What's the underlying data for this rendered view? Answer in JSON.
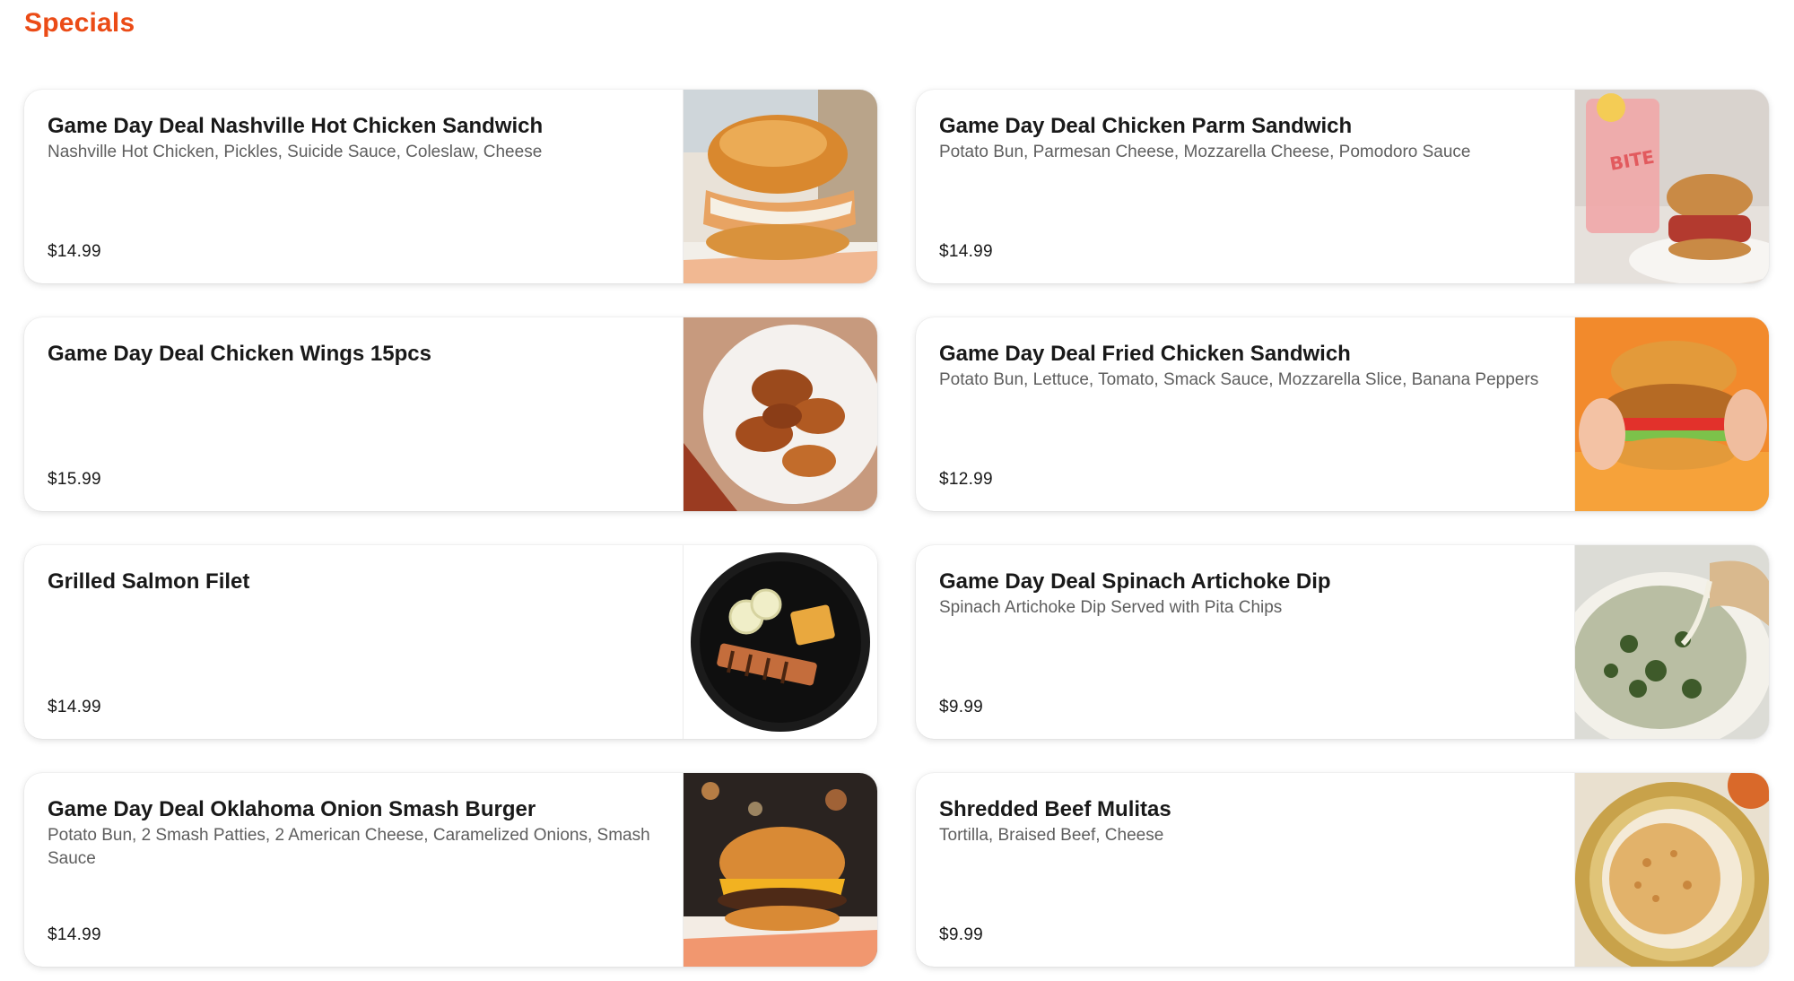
{
  "section": {
    "title": "Specials"
  },
  "items": [
    {
      "name": "Game Day Deal Nashville Hot Chicken Sandwich",
      "description": "Nashville Hot Chicken, Pickles, Suicide Sauce, Coleslaw, Cheese",
      "price": "$14.99",
      "image": "chicken-sandwich-photo"
    },
    {
      "name": "Game Day Deal Chicken Parm Sandwich",
      "description": "Potato Bun, Parmesan Cheese, Mozzarella Cheese, Pomodoro Sauce",
      "price": "$14.99",
      "image": "chicken-parm-photo"
    },
    {
      "name": "Game Day Deal Chicken Wings 15pcs",
      "description": "",
      "price": "$15.99",
      "image": "chicken-wings-photo"
    },
    {
      "name": "Game Day Deal Fried Chicken Sandwich",
      "description": "Potato Bun, Lettuce, Tomato, Smack Sauce, Mozzarella Slice, Banana Peppers",
      "price": "$12.99",
      "image": "fried-chicken-sandwich-photo"
    },
    {
      "name": "Grilled Salmon Filet",
      "description": "",
      "price": "$14.99",
      "image": "salmon-plate-photo"
    },
    {
      "name": "Game Day Deal Spinach Artichoke Dip",
      "description": "Spinach Artichoke Dip Served with Pita Chips",
      "price": "$9.99",
      "image": "spinach-dip-photo"
    },
    {
      "name": "Game Day Deal Oklahoma Onion Smash Burger",
      "description": "Potato Bun, 2 Smash Patties, 2 American Cheese, Caramelized Onions, Smash Sauce",
      "price": "$14.99",
      "image": "smash-burger-photo"
    },
    {
      "name": "Shredded Beef Mulitas",
      "description": "Tortilla, Braised Beef, Cheese",
      "price": "$9.99",
      "image": "mulitas-photo"
    }
  ]
}
